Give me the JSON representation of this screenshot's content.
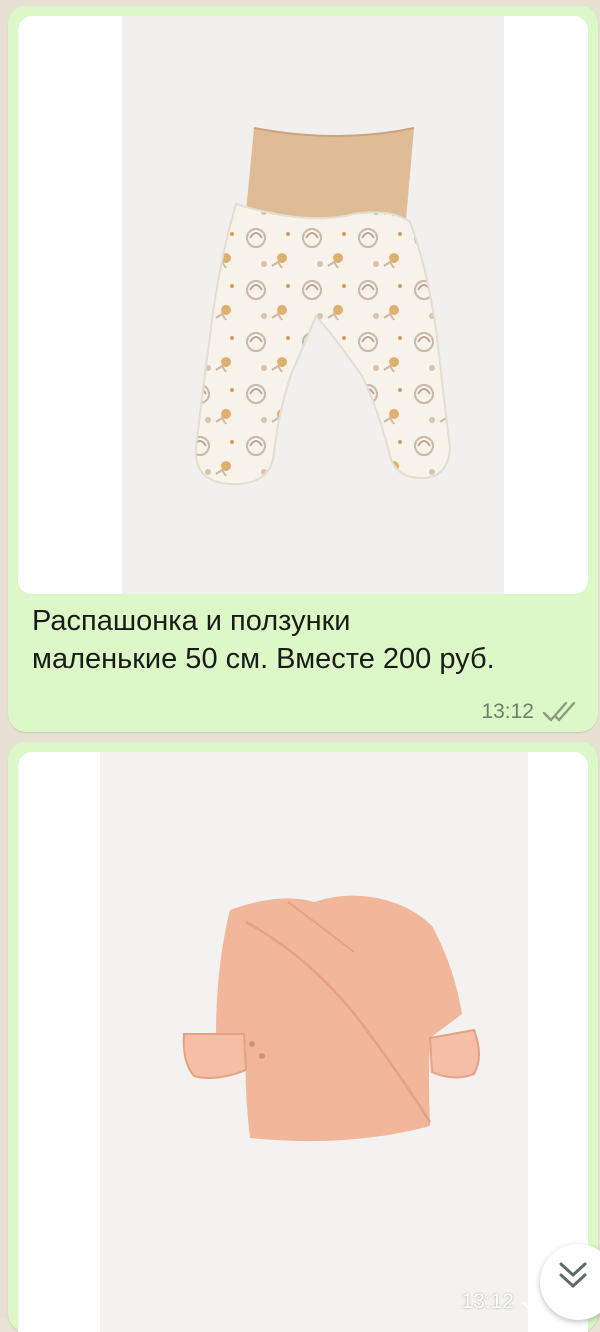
{
  "messages": [
    {
      "image_subject": "baby-pants-with-feet",
      "caption_lines": [
        "Распашонка и ползунки",
        "маленькие 50 см.  Вместе 200 руб."
      ],
      "time": "13:12",
      "status": "read"
    },
    {
      "image_subject": "baby-wrap-shirt",
      "time": "13:12",
      "status": "read"
    }
  ],
  "icons": {
    "read_receipt": "double-check-icon",
    "scroll_down": "chevron-double-down-icon"
  },
  "colors": {
    "bubble_outgoing": "#dcf8c6",
    "pants_waistband": "#dfbc95",
    "shirt": "#f2b69a",
    "read_ticks": "#8c9a85"
  }
}
